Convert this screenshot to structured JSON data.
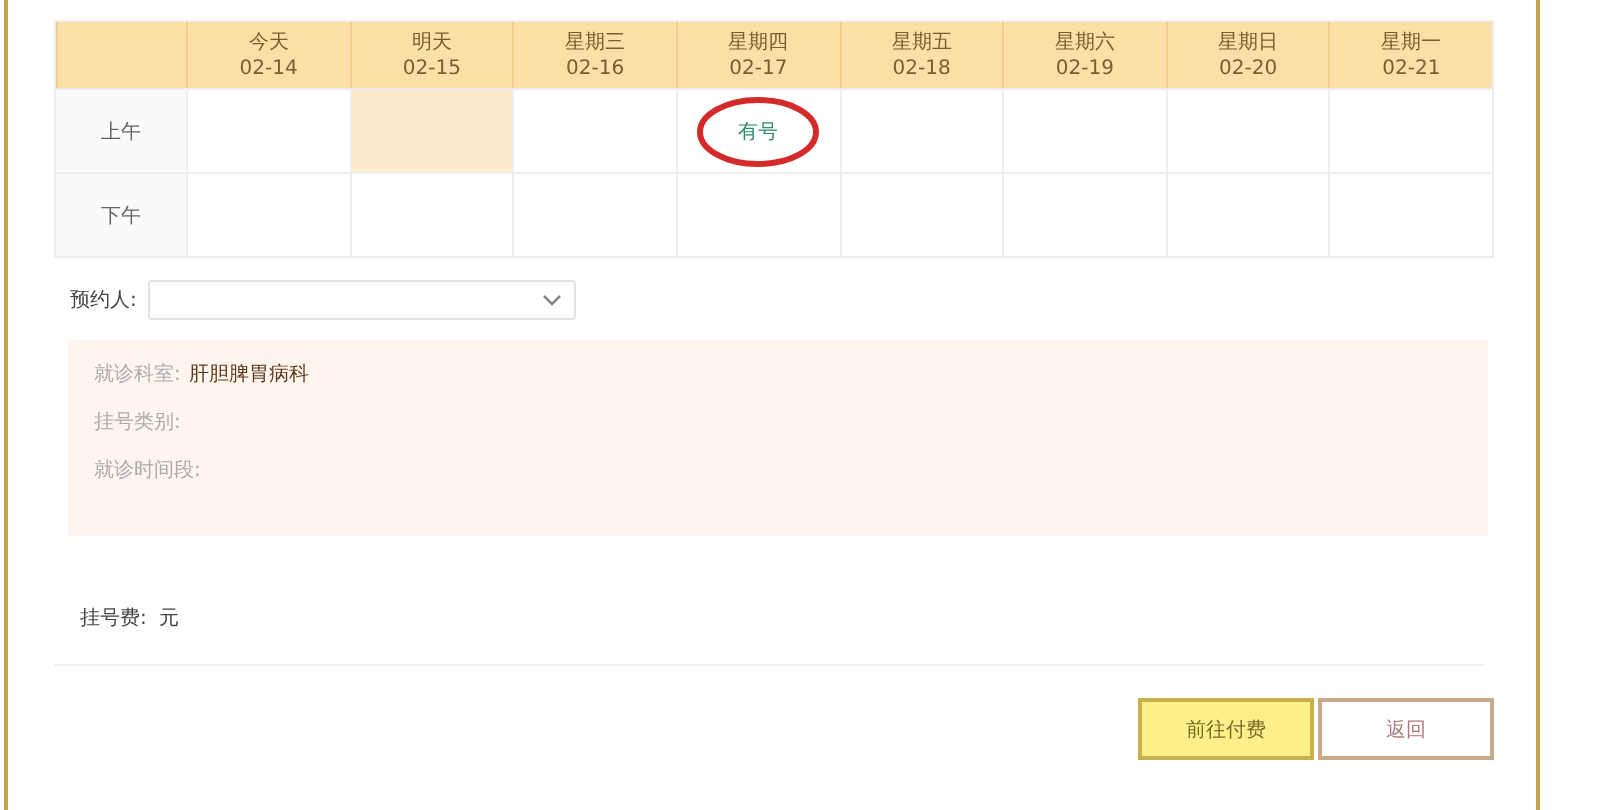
{
  "schedule": {
    "days": [
      {
        "name": "今天",
        "date": "02-14"
      },
      {
        "name": "明天",
        "date": "02-15"
      },
      {
        "name": "星期三",
        "date": "02-16"
      },
      {
        "name": "星期四",
        "date": "02-17"
      },
      {
        "name": "星期五",
        "date": "02-18"
      },
      {
        "name": "星期六",
        "date": "02-19"
      },
      {
        "name": "星期日",
        "date": "02-20"
      },
      {
        "name": "星期一",
        "date": "02-21"
      }
    ],
    "rows": [
      {
        "period": "上午",
        "cells": [
          {
            "text": "",
            "highlighted": false,
            "circled": false
          },
          {
            "text": "",
            "highlighted": true,
            "circled": false
          },
          {
            "text": "",
            "highlighted": false,
            "circled": false
          },
          {
            "text": "有号",
            "highlighted": false,
            "circled": true
          },
          {
            "text": "",
            "highlighted": false,
            "circled": false
          },
          {
            "text": "",
            "highlighted": false,
            "circled": false
          },
          {
            "text": "",
            "highlighted": false,
            "circled": false
          },
          {
            "text": "",
            "highlighted": false,
            "circled": false
          }
        ]
      },
      {
        "period": "下午",
        "cells": [
          {
            "text": "",
            "highlighted": false,
            "circled": false
          },
          {
            "text": "",
            "highlighted": false,
            "circled": false
          },
          {
            "text": "",
            "highlighted": false,
            "circled": false
          },
          {
            "text": "",
            "highlighted": false,
            "circled": false
          },
          {
            "text": "",
            "highlighted": false,
            "circled": false
          },
          {
            "text": "",
            "highlighted": false,
            "circled": false
          },
          {
            "text": "",
            "highlighted": false,
            "circled": false
          },
          {
            "text": "",
            "highlighted": false,
            "circled": false
          }
        ]
      }
    ]
  },
  "patient": {
    "label": "预约人:"
  },
  "details": [
    {
      "label": "就诊科室:",
      "value": "肝胆脾胃病科"
    },
    {
      "label": "挂号类别:"
    },
    {
      "label": "就诊时间段:"
    }
  ],
  "fee": {
    "label": "挂号费:",
    "unit": "元"
  },
  "buttons": [
    {
      "label": "前往付费",
      "kind": "primary"
    },
    {
      "label": "返回",
      "kind": "secondary"
    }
  ]
}
